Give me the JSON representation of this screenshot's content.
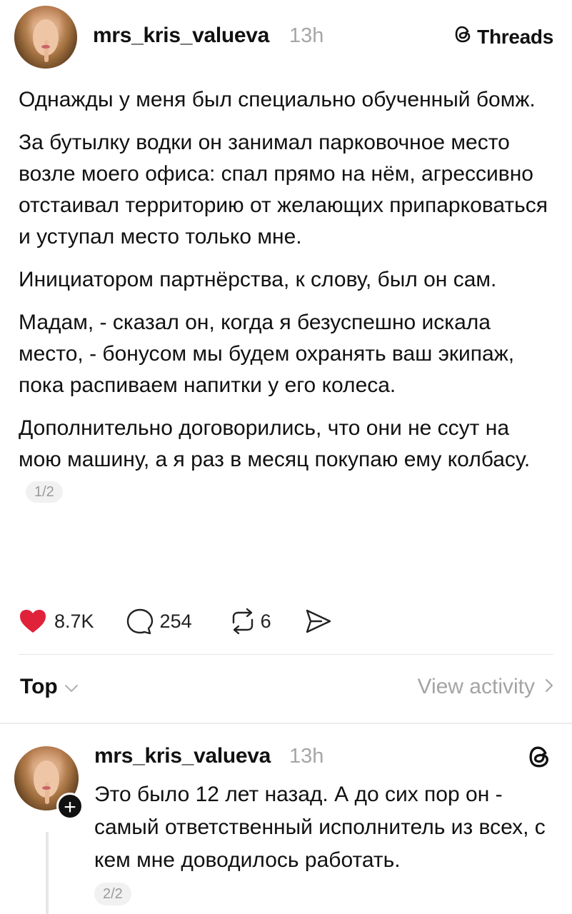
{
  "post": {
    "username": "mrs_kris_valueva",
    "time": "13h",
    "brand_label": "Threads",
    "paragraphs": [
      "Однажды у меня был специально обученный бомж.",
      "За бутылку водки он занимал парковочное место возле моего офиса: спал прямо на нём, агрессивно отстаивал территорию от желающих припарковаться и уступал место только мне.",
      "Инициатором партнёрства, к слову, был он сам.",
      "Мадам, - сказал он, когда я безуспешно искала место, - бонусом мы будем охранять ваш экипаж, пока распиваем напитки у его колеса.",
      "Дополнительно договорились, что они не ссут на мою машину, а я раз в месяц покупаю ему колбасу."
    ],
    "page_indicator": "1/2",
    "likes": "8.7K",
    "comments": "254",
    "reposts": "6",
    "like_color": "#e0213a"
  },
  "replies_header": {
    "sort_label": "Top",
    "view_activity_label": "View activity"
  },
  "reply": {
    "username": "mrs_kris_valueva",
    "time": "13h",
    "text": "Это было 12 лет назад. А до сих пор он - самый ответственный исполнитель из всех, с кем мне доводилось работать.",
    "page_indicator": "2/2",
    "follow_symbol": "+"
  }
}
